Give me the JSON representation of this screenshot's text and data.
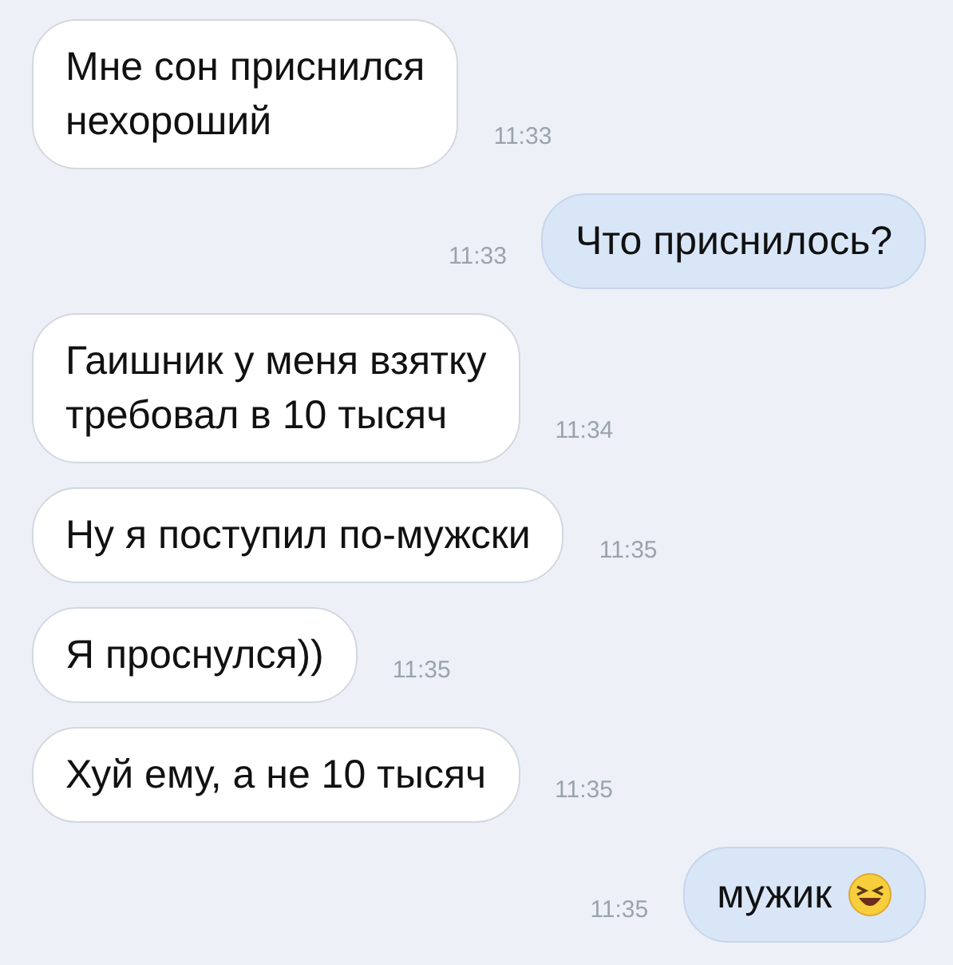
{
  "messages": [
    {
      "kind": "received",
      "text": "Мне сон приснился\nнехороший",
      "time": "11:33"
    },
    {
      "kind": "sent",
      "text": "Что приснилось?",
      "time": "11:33"
    },
    {
      "kind": "received",
      "text": "Гаишник у меня взятку\nтребовал в 10 тысяч",
      "time": "11:34"
    },
    {
      "kind": "received",
      "text": "Ну я поступил по-мужски",
      "time": "11:35"
    },
    {
      "kind": "received",
      "text": "Я проснулся))",
      "time": "11:35"
    },
    {
      "kind": "received",
      "text": "Хуй ему, а не 10 тысяч",
      "time": "11:35"
    },
    {
      "kind": "sent",
      "text": "мужик",
      "time": "11:35",
      "emoji": true
    }
  ]
}
